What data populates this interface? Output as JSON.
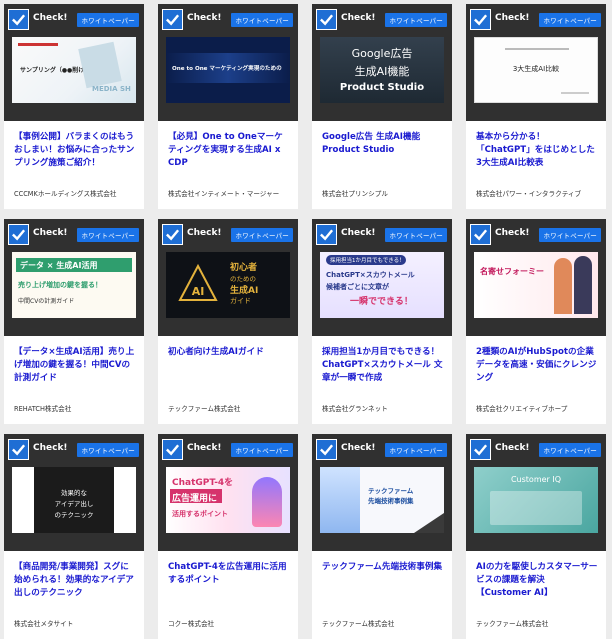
{
  "cards": [
    {
      "check": "Check!",
      "badge": "ホワイトペーパー",
      "title": "【事例公開】バラまくのはもうおしまい！お悩みに合ったサンプリング施策ご紹介！",
      "company": "CCCMKホールディングス株式会社",
      "thumb": {
        "line1": "サンプリング（●●削ける）",
        "line2": "MEDIA SH"
      }
    },
    {
      "check": "Check!",
      "badge": "ホワイトペーパー",
      "title": "【必見】One to Oneマーケティングを実現する生成AI x CDP",
      "company": "株式会社インティメート・マージャー",
      "thumb": {
        "line1": "One to One マーケティング実現のための"
      }
    },
    {
      "check": "Check!",
      "badge": "ホワイトペーパー",
      "title": "Google広告 生成AI機能 Product Studio",
      "company": "株式会社プリンシプル",
      "thumb": {
        "line1": "Google広告",
        "line2": "生成AI機能",
        "line3": "Product Studio"
      }
    },
    {
      "check": "Check!",
      "badge": "ホワイトペーパー",
      "title": "基本から分かる！「ChatGPT」をはじめとした3大生成AI比較表",
      "company": "株式会社パワー・インタラクティブ",
      "thumb": {
        "line1": "3大生成AI比較"
      }
    },
    {
      "check": "Check!",
      "badge": "ホワイトペーパー",
      "title": "【データ×生成AI活用】売り上げ増加の鍵を握る！中間CVの計測ガイド",
      "company": "REHATCH株式会社",
      "thumb": {
        "line1": "データ × 生成AI活用",
        "line2": "売り上げ増加の鍵を握る！",
        "line3": "中間CVの計測ガイド"
      }
    },
    {
      "check": "Check!",
      "badge": "ホワイトペーパー",
      "title": "初心者向け生成AIガイド",
      "company": "テックファーム株式会社",
      "thumb": {
        "line1": "初心者",
        "line2": "のための",
        "line3": "生成AI",
        "line4": "ガイド"
      }
    },
    {
      "check": "Check!",
      "badge": "ホワイトペーパー",
      "title": "採用担当1か月目でもできる！ChatGPT×スカウトメール 文章が一瞬で作成",
      "company": "株式会社グランネット",
      "thumb": {
        "line1": "採用担当1か月目でもできる！",
        "line2": "ChatGPT×スカウトメール",
        "line3": "候補者ごとに文章が",
        "line4": "一瞬でできる！"
      }
    },
    {
      "check": "Check!",
      "badge": "ホワイトペーパー",
      "title": "2種類のAIがHubSpotの企業データを高速・安価にクレンジング",
      "company": "株式会社クリエイティブホープ",
      "thumb": {
        "line1": "名寄せフォーミー"
      }
    },
    {
      "check": "Check!",
      "badge": "ホワイトペーパー",
      "title": "【商品開発/事業開発】スグに始められる！効果的なアイデア出しのテクニック",
      "company": "株式会社メタサイト",
      "thumb": {
        "line1": "効果的な",
        "line2": "アイデア出し",
        "line3": "のテクニック"
      }
    },
    {
      "check": "Check!",
      "badge": "ホワイトペーパー",
      "title": "ChatGPT-4を広告運用に活用するポイント",
      "company": "コクー株式会社",
      "thumb": {
        "line1": "ChatGPT-4を",
        "line2": "広告運用に",
        "line3": "活用するポイント"
      }
    },
    {
      "check": "Check!",
      "badge": "ホワイトペーパー",
      "title": "テックファーム先端技術事例集",
      "company": "テックファーム株式会社",
      "thumb": {
        "line1": "テックファーム",
        "line2": "先端技術事例集"
      }
    },
    {
      "check": "Check!",
      "badge": "ホワイトペーパー",
      "title": "AIの力を駆使しカスタマーサービスの課題を解決【Customer AI】",
      "company": "テックファーム株式会社",
      "thumb": {
        "line1": "Customer IQ"
      }
    }
  ]
}
